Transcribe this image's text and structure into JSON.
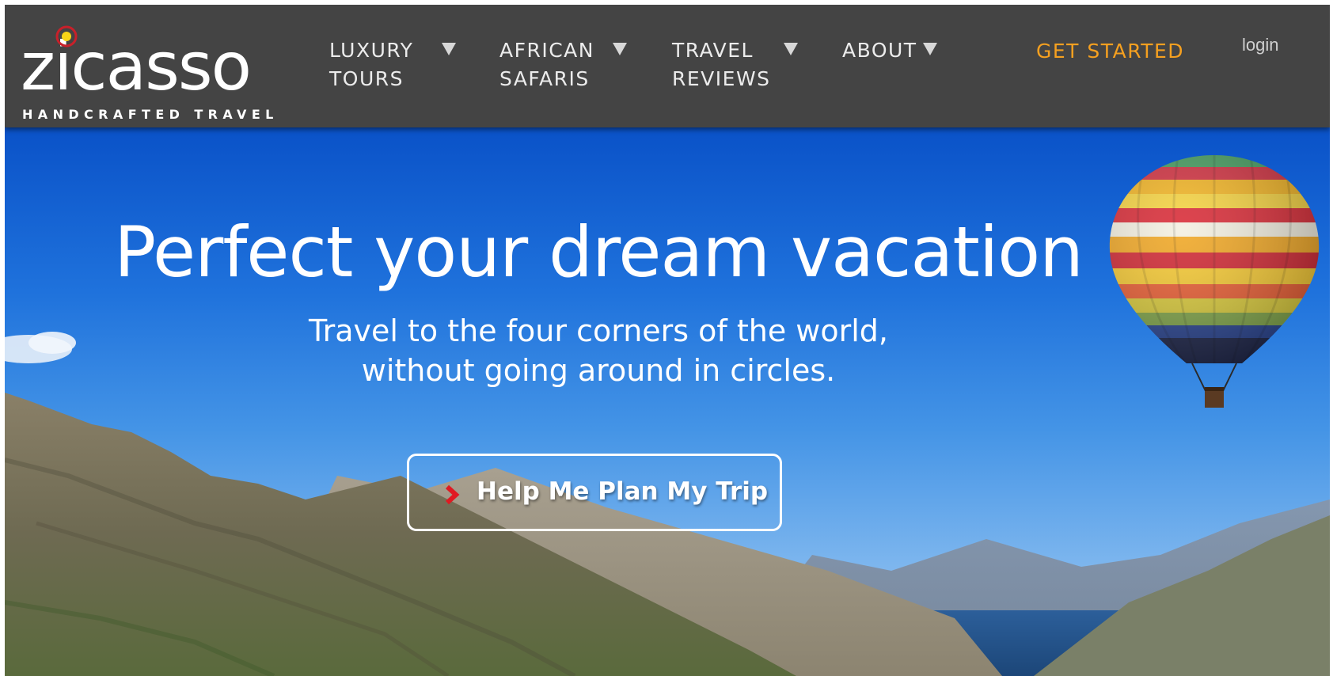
{
  "brand": {
    "name": "zicasso",
    "tagline": "HANDCRAFTED TRAVEL",
    "logo_icon": "target-dot-icon"
  },
  "nav": {
    "items": [
      {
        "line1": "LUXURY",
        "line2": "TOURS",
        "icon": "caret-down-icon"
      },
      {
        "line1": "AFRICAN",
        "line2": "SAFARIS",
        "icon": "caret-down-icon"
      },
      {
        "line1": "TRAVEL",
        "line2": "REVIEWS",
        "icon": "caret-down-icon"
      },
      {
        "line1": "ABOUT",
        "line2": "",
        "icon": "caret-down-icon"
      }
    ],
    "get_started": "GET STARTED",
    "login": "login"
  },
  "hero": {
    "title": "Perfect your dream vacation",
    "subtitle_line1": "Travel to the four corners of the world,",
    "subtitle_line2": "without going around in circles.",
    "cta_label": "Help Me Plan My Trip",
    "cta_icon": "chevron-right-icon",
    "background": "mountain-lake-sky-photo",
    "decoration": "hot-air-balloon"
  },
  "colors": {
    "nav_bg": "#444444",
    "accent_orange": "#f5a020",
    "logo_red": "#c8202a",
    "logo_yellow": "#f7d417",
    "cta_arrow_red": "#e01a22",
    "sky_blue": "#1f72dc"
  }
}
